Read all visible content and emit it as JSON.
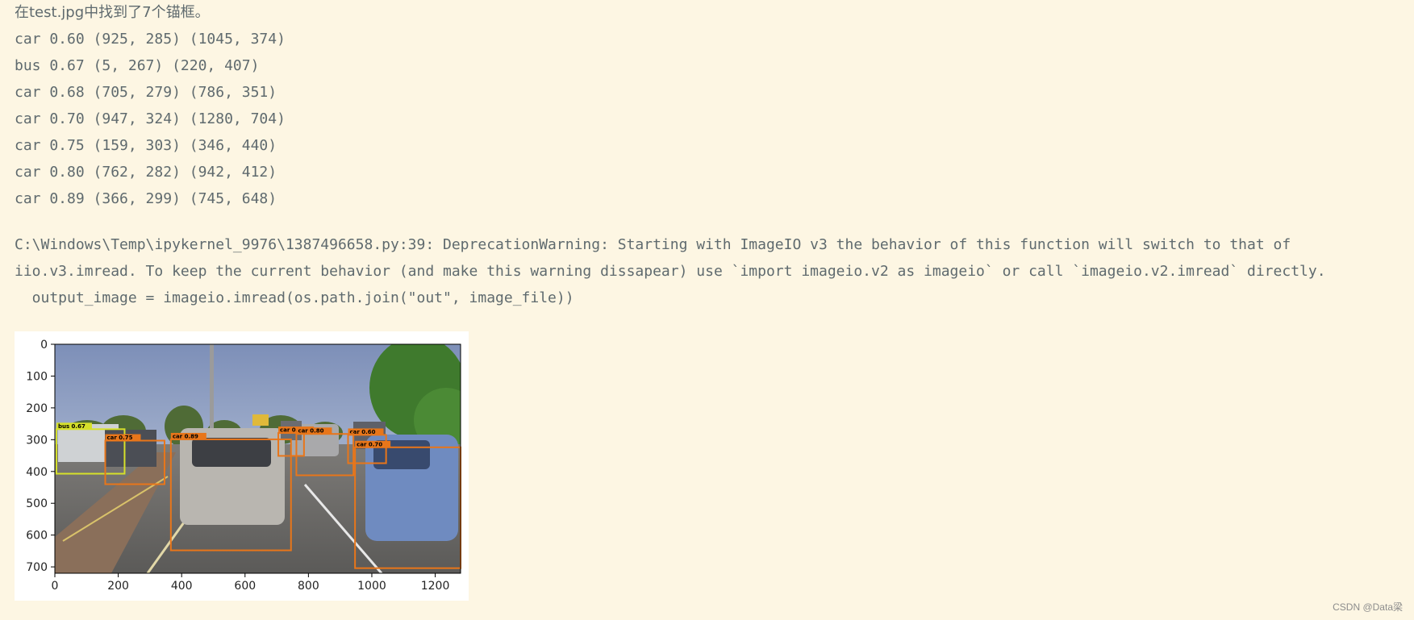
{
  "output": {
    "summary": "在test.jpg中找到了7个锚框。",
    "detections": [
      "car 0.60 (925, 285) (1045, 374)",
      "bus 0.67 (5, 267) (220, 407)",
      "car 0.68 (705, 279) (786, 351)",
      "car 0.70 (947, 324) (1280, 704)",
      "car 0.75 (159, 303) (346, 440)",
      "car 0.80 (762, 282) (942, 412)",
      "car 0.89 (366, 299) (745, 648)"
    ],
    "warning_line1": "C:\\Windows\\Temp\\ipykernel_9976\\1387496658.py:39: DeprecationWarning: Starting with ImageIO v3 the behavior of this function will switch to that of",
    "warning_line2": "iio.v3.imread. To keep the current behavior (and make this warning dissapear) use `import imageio.v2 as imageio` or call `imageio.v2.imread` directly.",
    "warning_line3": "  output_image = imageio.imread(os.path.join(\"out\", image_file))"
  },
  "figure": {
    "x_ticks": [
      "0",
      "200",
      "400",
      "600",
      "800",
      "1000",
      "1200"
    ],
    "y_ticks": [
      "0",
      "100",
      "200",
      "300",
      "400",
      "500",
      "600",
      "700"
    ],
    "boxes": [
      {
        "label": "car 0.60",
        "color": "#e8761a",
        "x1": 925,
        "y1": 285,
        "x2": 1045,
        "y2": 374
      },
      {
        "label": "bus 0.67",
        "color": "#d6e02a",
        "x1": 5,
        "y1": 267,
        "x2": 220,
        "y2": 407
      },
      {
        "label": "car 0.68",
        "color": "#e8761a",
        "x1": 705,
        "y1": 279,
        "x2": 786,
        "y2": 351
      },
      {
        "label": "car 0.70",
        "color": "#e8761a",
        "x1": 947,
        "y1": 324,
        "x2": 1280,
        "y2": 704
      },
      {
        "label": "car 0.75",
        "color": "#e8761a",
        "x1": 159,
        "y1": 303,
        "x2": 346,
        "y2": 440
      },
      {
        "label": "car 0.80",
        "color": "#e8761a",
        "x1": 762,
        "y1": 282,
        "x2": 942,
        "y2": 412
      },
      {
        "label": "car 0.89",
        "color": "#e8761a",
        "x1": 366,
        "y1": 299,
        "x2": 745,
        "y2": 648
      }
    ]
  },
  "watermark": "CSDN @Data梁"
}
